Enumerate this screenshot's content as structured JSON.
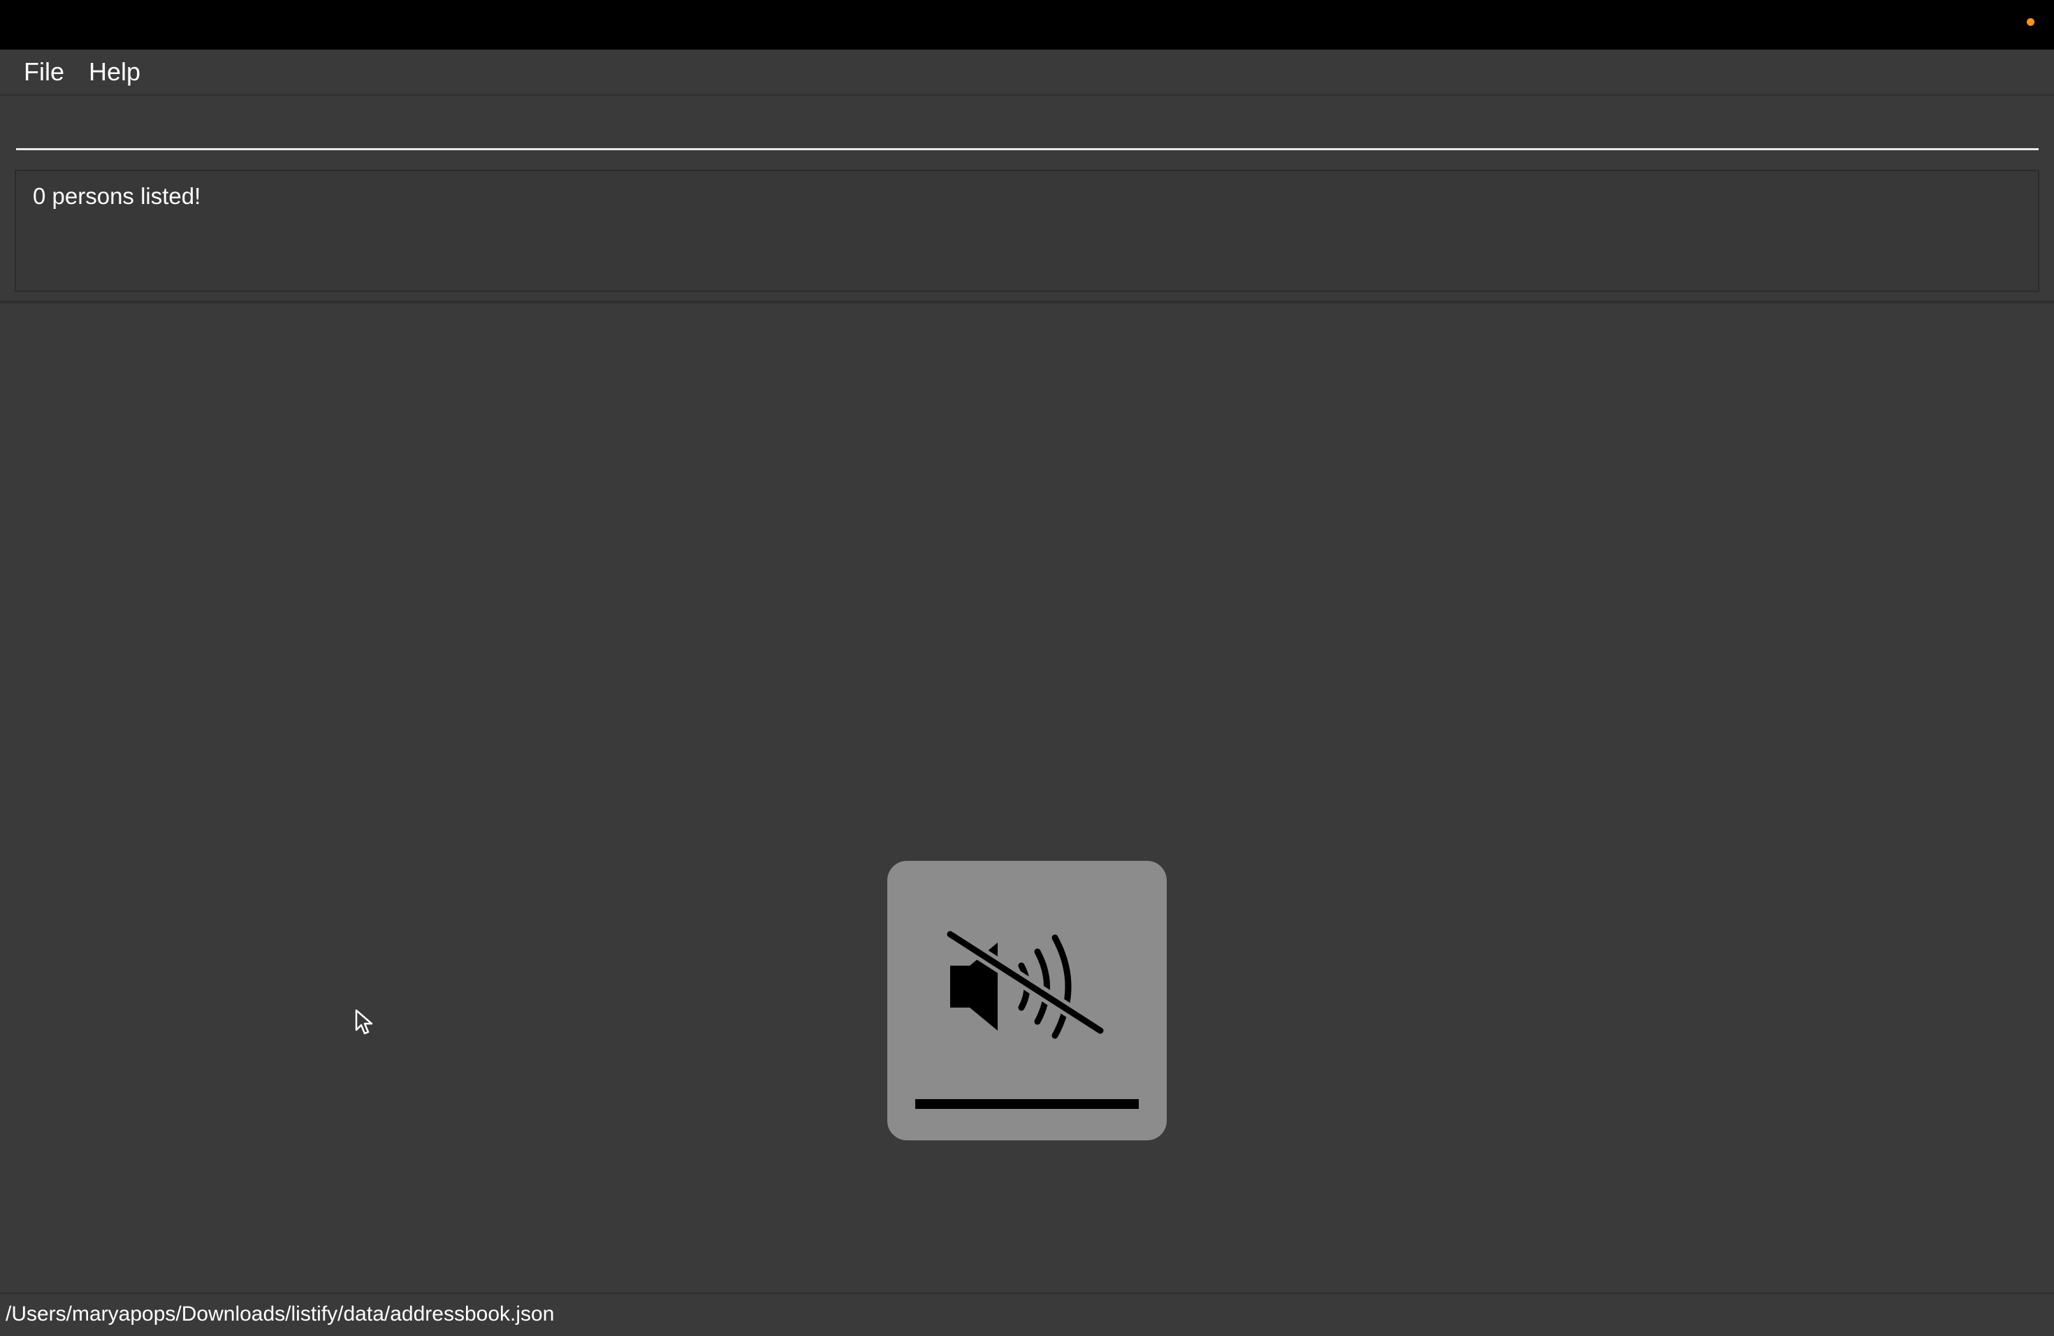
{
  "system_bar": {
    "indicator_color": "#f7931e"
  },
  "menu": {
    "items": [
      {
        "label": "File"
      },
      {
        "label": "Help"
      }
    ]
  },
  "command_box": {
    "value": "",
    "placeholder": ""
  },
  "result_display": {
    "text": "0 persons listed!"
  },
  "volume_hud": {
    "icon": "speaker-muted-icon",
    "level": 0
  },
  "status_bar": {
    "file_path": "/Users/maryapops/Downloads/listify/data/addressbook.json"
  },
  "colors": {
    "background": "#3a3a3a",
    "topbar": "#000000",
    "hud_background": "#8c8c8c"
  }
}
